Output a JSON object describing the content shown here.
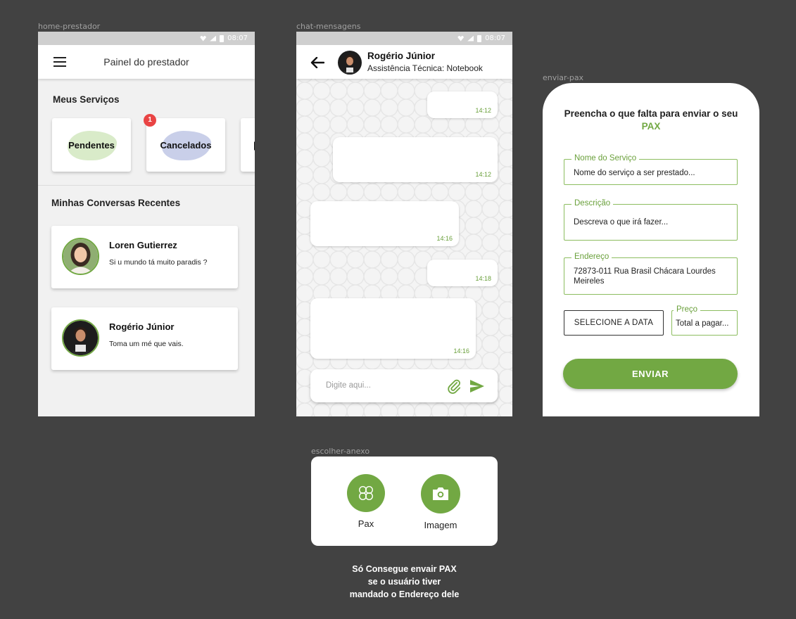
{
  "frames": {
    "home": "home-prestador",
    "chat": "chat-mensagens",
    "pax": "enviar-pax",
    "anexo": "escolher-anexo"
  },
  "statusbar": {
    "time": "08:07"
  },
  "home": {
    "title": "Painel do prestador",
    "services_title": "Meus Serviços",
    "services": [
      {
        "label": "Pendentes",
        "color": "#d9ebc9"
      },
      {
        "label": "Cancelados",
        "color": "#c9cfe9",
        "badge": "1"
      }
    ],
    "conversations_title": "Minhas Conversas Recentes",
    "conversations": [
      {
        "name": "Loren Gutierrez",
        "message": "Si u mundo tá muito paradis ?"
      },
      {
        "name": "Rogério Júnior",
        "message": "Toma um mé que vais."
      }
    ]
  },
  "chat": {
    "contact_name": "Rogério Júnior",
    "contact_subtitle": "Assistência Técnica: Notebook",
    "messages": [
      {
        "side": "right",
        "time": "14:12"
      },
      {
        "side": "right",
        "time": "14:12"
      },
      {
        "side": "left",
        "time": "14:16"
      },
      {
        "side": "right",
        "time": "14:18"
      },
      {
        "side": "left",
        "time": "14:16"
      }
    ],
    "input_placeholder": "Digite aqui..."
  },
  "pax": {
    "heading_prefix": "Preencha o que falta para enviar o seu",
    "heading_accent": "PAX",
    "fields": {
      "service_name": {
        "label": "Nome do Serviço",
        "value": "Nome do serviço a ser prestado..."
      },
      "description": {
        "label": "Descrição",
        "value": "Descreva o que irá fazer..."
      },
      "address": {
        "label": "Endereço",
        "value": "72873-011 Rua Brasil Chácara Lourdes Meireles"
      },
      "price": {
        "label": "Preço",
        "value": "Total a pagar..."
      }
    },
    "date_button": "SELECIONE A DATA",
    "submit_button": "ENVIAR"
  },
  "anexo": {
    "options": [
      {
        "label": "Pax",
        "icon": "clover-icon"
      },
      {
        "label": "Imagem",
        "icon": "camera-icon"
      }
    ]
  },
  "note": {
    "line1": "Só Consegue envair PAX",
    "line2": "se o usuário tiver",
    "line3": "mandado o Endereço dele"
  },
  "colors": {
    "accent": "#72a843",
    "badge": "#e94444",
    "background": "#424242"
  }
}
